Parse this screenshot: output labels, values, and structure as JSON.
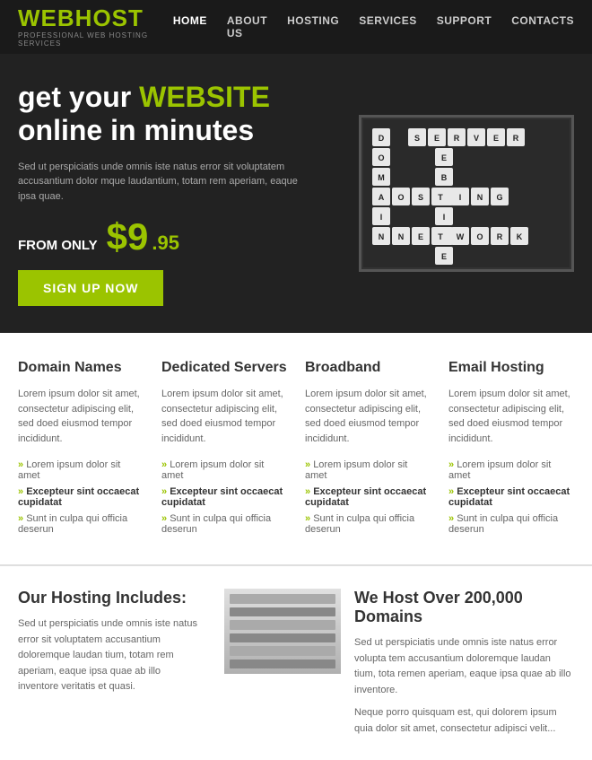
{
  "header": {
    "logo_web": "WEB",
    "logo_host": "HOST",
    "logo_sub": "PROFESSIONAL WEB HOSTING SERVICES",
    "nav": [
      {
        "label": "HOME",
        "active": true
      },
      {
        "label": "ABOUT US",
        "active": false
      },
      {
        "label": "HOSTING",
        "active": false
      },
      {
        "label": "SERVICES",
        "active": false
      },
      {
        "label": "SUPPORT",
        "active": false
      },
      {
        "label": "CONTACTS",
        "active": false
      }
    ]
  },
  "hero": {
    "title_line1": "get your ",
    "title_highlight": "WEBSITE",
    "title_line2": "online in minutes",
    "description": "Sed ut perspiciatis unde omnis iste natus error sit voluptatem accusantium dolor mque laudantium, totam rem aperiam, eaque ipsa quae.",
    "from_only": "FROM ONLY",
    "price_dollar": "$9",
    "price_cents": ".95",
    "cta_label": "SIGN UP NOW"
  },
  "features": [
    {
      "title": "Domain Names",
      "text": "Lorem ipsum dolor sit amet, consectetur adipiscing elit, sed doed eiusmod tempor incididunt.",
      "items": [
        {
          "text": "Lorem ipsum dolor sit amet",
          "bold": false
        },
        {
          "text": "Excepteur sint occaecat cupidatat",
          "bold": true
        },
        {
          "text": "Sunt in culpa qui officia deserun",
          "bold": false
        }
      ]
    },
    {
      "title": "Dedicated Servers",
      "text": "Lorem ipsum dolor sit amet, consectetur adipiscing elit, sed doed eiusmod tempor incididunt.",
      "items": [
        {
          "text": "Lorem ipsum dolor sit amet",
          "bold": false
        },
        {
          "text": "Excepteur sint occaecat cupidatat",
          "bold": true
        },
        {
          "text": "Sunt in culpa qui officia deserun",
          "bold": false
        }
      ]
    },
    {
      "title": "Broadband",
      "text": "Lorem ipsum dolor sit amet, consectetur adipiscing elit, sed doed eiusmod tempor incididunt.",
      "items": [
        {
          "text": "Lorem ipsum dolor sit amet",
          "bold": false
        },
        {
          "text": "Excepteur sint occaecat cupidatat",
          "bold": true
        },
        {
          "text": "Sunt in culpa qui officia deserun",
          "bold": false
        }
      ]
    },
    {
      "title": "Email Hosting",
      "text": "Lorem ipsum dolor sit amet, consectetur adipiscing elit, sed doed eiusmod tempor incididunt.",
      "items": [
        {
          "text": "Lorem ipsum dolor sit amet",
          "bold": false
        },
        {
          "text": "Excepteur sint occaecat cupidatat",
          "bold": true
        },
        {
          "text": "Sunt in culpa qui officia deserun",
          "bold": false
        }
      ]
    }
  ],
  "bottom": {
    "left_title": "Our Hosting Includes:",
    "left_text": "Sed ut perspiciatis unde omnis iste natus error sit voluptatem accusantium doloremque laudan tium, totam rem aperiam, eaque ipsa quae ab illo inventore veritatis et quasi.",
    "right_title": "We Host Over 200,000 Domains",
    "right_text1": "Sed ut perspiciatis unde omnis iste natus error volupta tem accusantium doloremque laudan tium, tota remen aperiam, eaque ipsa quae ab illo inventore.",
    "right_text2": "Neque porro quisquam est, qui dolorem ipsum quia dolor sit amet, consectetur adipisci velit..."
  }
}
